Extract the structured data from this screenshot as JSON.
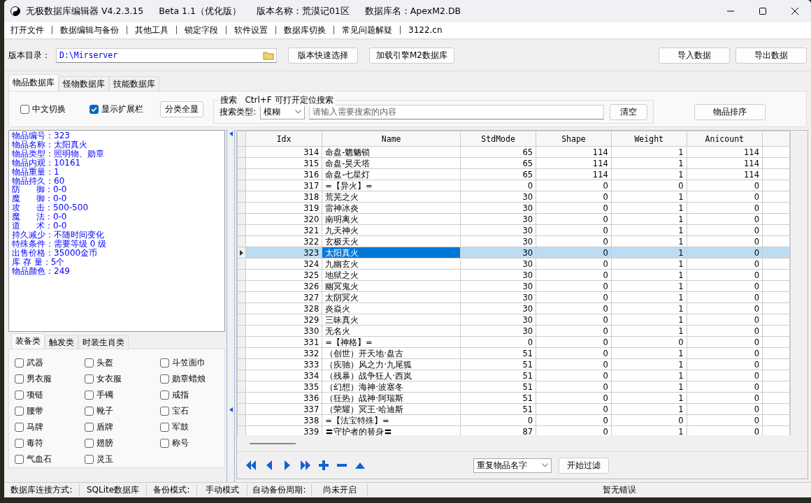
{
  "window": {
    "title_parts": [
      "无极数据库编辑器 V4.2.3.15",
      "Beta 1.1（优化版）",
      "版本名称：荒漠记01区",
      "数据库名：ApexM2.DB"
    ]
  },
  "menu": [
    "打开文件",
    "数据编辑与备份",
    "其他工具",
    "锁定字段",
    "软件设置",
    "数据库切换",
    "常见问题解疑",
    "3122.cn"
  ],
  "toolbar": {
    "dir_label": "版本目录：",
    "dir_value": "D:\\Mirserver",
    "buttons": [
      "版本快速选择",
      "加载引擎M2数据库"
    ],
    "right_buttons": [
      "导入数据",
      "导出数据"
    ]
  },
  "db_tabs": [
    {
      "label": "物品数据库",
      "selected": true
    },
    {
      "label": "怪物数据库",
      "selected": false
    },
    {
      "label": "技能数据库",
      "selected": false
    }
  ],
  "options": [
    {
      "label": "中文切换",
      "checked": false
    },
    {
      "label": "显示扩展栏",
      "checked": true
    }
  ],
  "show_all_button": "分类全显",
  "search": {
    "legend": "搜索   Ctrl+F 可打开定位搜索",
    "type_label": "搜索类型:",
    "type_value": "模糊",
    "placeholder": "请输入需要搜索的内容",
    "clear_button": "清空"
  },
  "sort_button": "物品排序",
  "info_lines": [
    "物品编号：323",
    "物品名称：太阳真火",
    "物品类型：照明物、勋章",
    "物品内观：10161",
    "物品重量：1",
    "物品持久：60",
    "防      御：0-0",
    "魔      御：0-0",
    "攻      击：500-500",
    "魔      法：0-0",
    "道      术：0-0",
    "持久减少：不随时间变化",
    "特殊条件：需要等级 0 级",
    "出售价格：35000金币",
    "库 存 量：5个",
    "物品颜色：249"
  ],
  "category_tabs": [
    {
      "label": "装备类",
      "selected": true
    },
    {
      "label": "触发类",
      "selected": false
    },
    {
      "label": "时装生肖类",
      "selected": false
    }
  ],
  "categories": [
    {
      "label": "武器",
      "checked": false
    },
    {
      "label": "头盔",
      "checked": false
    },
    {
      "label": "斗笠面巾",
      "checked": false
    },
    {
      "label": "男衣服",
      "checked": false
    },
    {
      "label": "女衣服",
      "checked": false
    },
    {
      "label": "勋章蜡烛",
      "checked": false
    },
    {
      "label": "项链",
      "checked": false
    },
    {
      "label": "手镯",
      "checked": false
    },
    {
      "label": "戒指",
      "checked": false
    },
    {
      "label": "腰带",
      "checked": false
    },
    {
      "label": "靴子",
      "checked": false
    },
    {
      "label": "宝石",
      "checked": false
    },
    {
      "label": "马牌",
      "checked": false
    },
    {
      "label": "盾牌",
      "checked": false
    },
    {
      "label": "军鼓",
      "checked": false
    },
    {
      "label": "毒符",
      "checked": false
    },
    {
      "label": "翅膀",
      "checked": false
    },
    {
      "label": "称号",
      "checked": false
    },
    {
      "label": "气血石",
      "checked": false
    },
    {
      "label": "灵玉",
      "checked": false
    }
  ],
  "table": {
    "columns": [
      "Idx",
      "Name",
      "StdMode",
      "Shape",
      "Weight",
      "Anicount"
    ],
    "rows": [
      {
        "cells": [
          "314",
          "命盘-魍魉锁",
          "65",
          "114",
          "1",
          "114"
        ],
        "selected": false
      },
      {
        "cells": [
          "315",
          "命盘-昊天塔",
          "65",
          "114",
          "1",
          "114"
        ],
        "selected": false
      },
      {
        "cells": [
          "316",
          "命盘-七星灯",
          "65",
          "114",
          "1",
          "114"
        ],
        "selected": false
      },
      {
        "cells": [
          "317",
          "=【异火】=",
          "0",
          "0",
          "0",
          "0"
        ],
        "selected": false
      },
      {
        "cells": [
          "318",
          "荒芜之火",
          "30",
          "0",
          "1",
          "0"
        ],
        "selected": false
      },
      {
        "cells": [
          "319",
          "雷神冰炎",
          "30",
          "0",
          "1",
          "0"
        ],
        "selected": false
      },
      {
        "cells": [
          "320",
          "南明离火",
          "30",
          "0",
          "1",
          "0"
        ],
        "selected": false
      },
      {
        "cells": [
          "321",
          "九天神火",
          "30",
          "0",
          "1",
          "0"
        ],
        "selected": false
      },
      {
        "cells": [
          "322",
          "玄极天火",
          "30",
          "0",
          "1",
          "0"
        ],
        "selected": false
      },
      {
        "cells": [
          "323",
          "太阳真火",
          "30",
          "0",
          "1",
          "0"
        ],
        "selected": true
      },
      {
        "cells": [
          "324",
          "九幽玄火",
          "30",
          "0",
          "1",
          "0"
        ],
        "selected": false
      },
      {
        "cells": [
          "325",
          "地狱之火",
          "30",
          "0",
          "1",
          "0"
        ],
        "selected": false
      },
      {
        "cells": [
          "326",
          "幽冥鬼火",
          "30",
          "0",
          "1",
          "0"
        ],
        "selected": false
      },
      {
        "cells": [
          "327",
          "太阴冥火",
          "30",
          "0",
          "1",
          "0"
        ],
        "selected": false
      },
      {
        "cells": [
          "328",
          "炎焱火",
          "30",
          "0",
          "1",
          "0"
        ],
        "selected": false
      },
      {
        "cells": [
          "329",
          "三昧真火",
          "30",
          "0",
          "1",
          "0"
        ],
        "selected": false
      },
      {
        "cells": [
          "330",
          "无名火",
          "30",
          "0",
          "1",
          "0"
        ],
        "selected": false
      },
      {
        "cells": [
          "331",
          "=【神格】=",
          "0",
          "0",
          "0",
          "0"
        ],
        "selected": false
      },
      {
        "cells": [
          "332",
          "（创世）开天地·盘古",
          "51",
          "0",
          "1",
          "0"
        ],
        "selected": false
      },
      {
        "cells": [
          "333",
          "（疾驰）风之力·九尾狐",
          "51",
          "0",
          "1",
          "0"
        ],
        "selected": false
      },
      {
        "cells": [
          "334",
          "（残暴）战争狂人·西岚",
          "51",
          "0",
          "1",
          "0"
        ],
        "selected": false
      },
      {
        "cells": [
          "335",
          "（幻想）海神·波塞冬",
          "51",
          "0",
          "1",
          "0"
        ],
        "selected": false
      },
      {
        "cells": [
          "336",
          "（狂热）战神·阿瑞斯",
          "51",
          "0",
          "1",
          "0"
        ],
        "selected": false
      },
      {
        "cells": [
          "337",
          "（荣耀）冥王·哈迪斯",
          "51",
          "0",
          "1",
          "0"
        ],
        "selected": false
      },
      {
        "cells": [
          "338",
          "=【法宝特殊】=",
          "0",
          "0",
          "0",
          "0"
        ],
        "selected": false
      },
      {
        "cells": [
          "339",
          "〓守护者的替身〓",
          "87",
          "0",
          "1",
          "0"
        ],
        "selected": false
      }
    ]
  },
  "nav_buttons": [
    {
      "kind": "first"
    },
    {
      "kind": "prev"
    },
    {
      "kind": "next"
    },
    {
      "kind": "last"
    },
    {
      "kind": "add"
    },
    {
      "kind": "remove"
    },
    {
      "kind": "edit"
    }
  ],
  "filter": {
    "value": "重复物品名字",
    "button": "开始过滤"
  },
  "status_bar": {
    "items": [
      "数据库连接方式:",
      "SQLite数据库",
      "备份模式:",
      "手动模式",
      "自动备份周期:",
      "尚未开启"
    ],
    "message": "暂无错误"
  }
}
